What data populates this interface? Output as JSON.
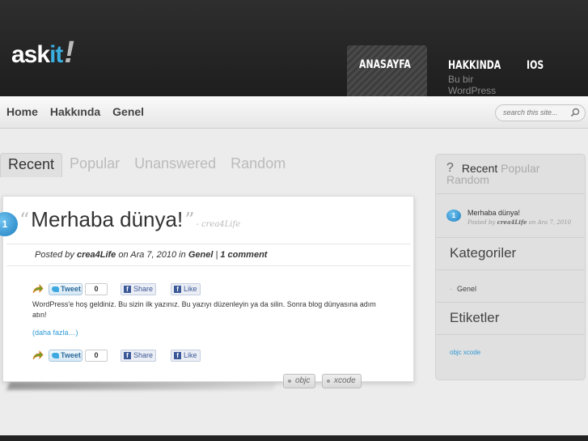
{
  "header": {
    "logo": {
      "ask": "ask",
      "it": "it",
      "bang": "!"
    },
    "nav": [
      {
        "label": "ANASAYFA"
      },
      {
        "label": "HAKKINDA"
      },
      {
        "label": "IOS"
      }
    ],
    "nav_sub": "Bu bir WordPress sayf"
  },
  "subnav": {
    "links": [
      "Home",
      "Hakkında",
      "Genel"
    ],
    "search_placeholder": "search this site..."
  },
  "tabs": [
    "Recent",
    "Popular",
    "Unanswered",
    "Random"
  ],
  "post": {
    "comment_count": "1",
    "title": "Merhaba dünya!",
    "author_tag": "- crea4Life",
    "meta": {
      "posted_by": "Posted by",
      "author": "crea4Life",
      "on": "on Ara 7, 2010 in",
      "category": "Genel",
      "sep": "|",
      "comments": "1 comment"
    },
    "share": {
      "tweet": "Tweet",
      "count": "0",
      "share": "Share",
      "like": "Like"
    },
    "excerpt": "WordPress'e hoş geldiniz. Bu sizin ilk yazınız. Bu yazıyı düzenleyin ya da silin. Sonra blog dünyasına adım atın!",
    "more": "(daha fazla…)",
    "tags": [
      "objc",
      "xcode"
    ]
  },
  "sidebar": {
    "tab_icon": "?",
    "tabs": [
      "Recent",
      "Popular",
      "Random"
    ],
    "recent": {
      "count": "1",
      "title": "Merhaba dünya!",
      "meta_prefix": "Posted by",
      "author": "crea4Life",
      "meta_suffix": "on Ara 7, 2010"
    },
    "categories_title": "Kategoriler",
    "categories": [
      "Genel"
    ],
    "tags_title": "Etiketler",
    "tags": "objc xcode"
  },
  "colors": {
    "accent": "#3aaee0",
    "link": "#2f9ad6",
    "header_bg": "#262626"
  }
}
